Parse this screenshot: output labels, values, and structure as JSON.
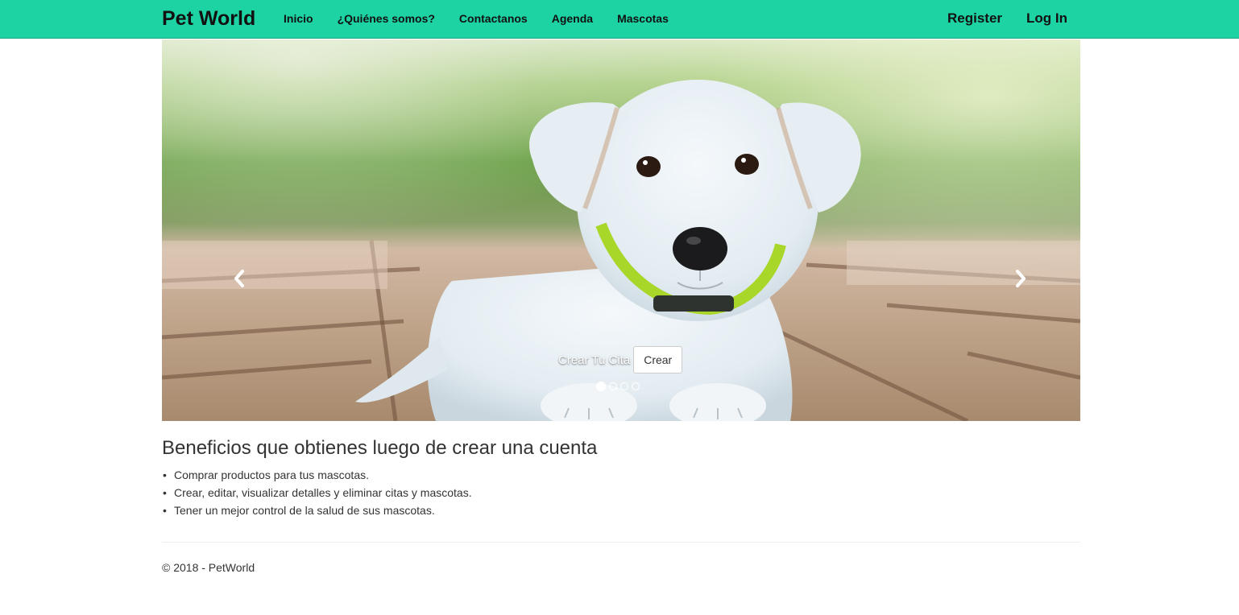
{
  "brand": "Pet World",
  "nav": {
    "links": [
      "Inicio",
      "¿Quiénes somos?",
      "Contactanos",
      "Agenda",
      "Mascotas"
    ],
    "right": [
      "Register",
      "Log In"
    ]
  },
  "carousel": {
    "image": "white-puppy-photo",
    "caption_text": "Crear Tu Cita",
    "button_label": "Crear",
    "slide_count": 4,
    "active_slide": 1,
    "prev_icon": "chevron-left-icon",
    "next_icon": "chevron-right-icon"
  },
  "benefits": {
    "heading": "Beneficios que obtienes luego de crear una cuenta",
    "bullet": "•",
    "items": [
      "Comprar productos para tus mascotas.",
      "Crear, editar, visualizar detalles y eliminar citas y mascotas.",
      "Tener un mejor control de la salud de sus mascotas."
    ]
  },
  "footer": {
    "text": "© 2018 - PetWorld"
  },
  "colors": {
    "navbar": "#1dd3a3",
    "text": "#333333",
    "collar": "#a8d629"
  }
}
